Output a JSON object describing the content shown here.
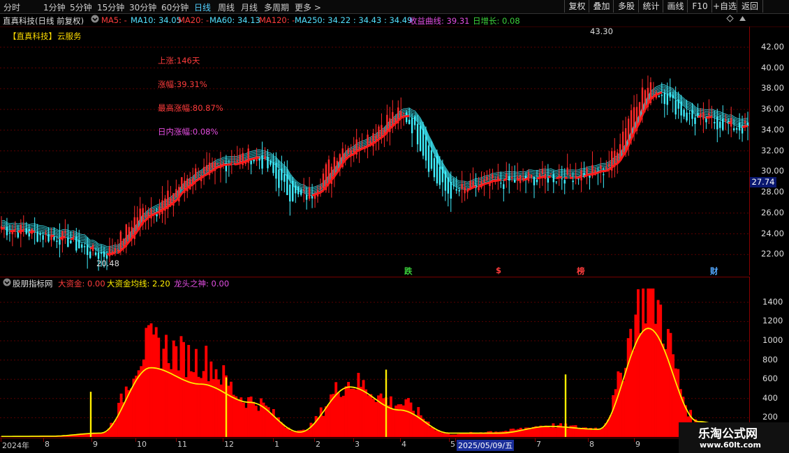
{
  "toolbar": {
    "periods": [
      "分时",
      "1分钟",
      "5分钟",
      "15分钟",
      "30分钟",
      "60分钟",
      "日线",
      "周线",
      "月线",
      "多周期",
      "更多 >"
    ],
    "active_period": "日线",
    "right_buttons": [
      "复权",
      "叠加",
      "多股",
      "统计",
      "画线",
      "F10",
      "+自选",
      "返回"
    ]
  },
  "info": {
    "title": "直真科技(日线 前复权)",
    "ma5": "MA5: -",
    "ma10": "MA10: 34.05",
    "ma20": "MA20: -",
    "ma60": "MA60: 34.13",
    "ma120": "MA120: -",
    "ma250": "MA250: 34.22 : 34.43 : 34.49",
    "profit": "收益曲线: 39.31",
    "daygrowth": "日增长: 0.08"
  },
  "cloud": {
    "stock": "【直真科技】",
    "service": "云服务"
  },
  "stats": {
    "rise_days": "上涨:146天",
    "change": "涨幅:39.31%",
    "max_change": "最高涨幅:80.87%",
    "intraday": "日内涨幅:0.08%"
  },
  "price": {
    "high_label": "43.30",
    "low_label": "20.48",
    "current_tag": "27.74",
    "yticks": [
      "42.00",
      "40.00",
      "38.00",
      "36.00",
      "34.00",
      "32.00",
      "30.00",
      "28.00",
      "26.00",
      "24.00",
      "22.00"
    ]
  },
  "markers": [
    "跌",
    "$",
    "榜",
    "财"
  ],
  "indicator": {
    "name": "股朋指标网",
    "big_fund": "大资金: 0.00",
    "big_fund_avg": "大资金均线: 2.20",
    "dragon": "龙头之神: 0.00",
    "yticks": [
      "1400",
      "1200",
      "1000",
      "800",
      "600",
      "400",
      "200"
    ]
  },
  "dates": [
    "2024年",
    "8",
    "9",
    "10",
    "11",
    "12",
    "1",
    "2",
    "3",
    "4",
    "5",
    "2025/05/09/五",
    "7",
    "8",
    "9"
  ],
  "watermark": {
    "name": "乐淘公式网",
    "url": "www.60lt.com"
  },
  "chart_data": {
    "type": "line",
    "price": {
      "ylim": [
        20,
        44
      ],
      "x": [
        "2024-07",
        "2024-08",
        "2024-09",
        "2024-10",
        "2024-11",
        "2024-12",
        "2025-01",
        "2025-02",
        "2025-03",
        "2025-04",
        "2025-05",
        "2025-06",
        "2025-07",
        "2025-08",
        "2025-09",
        "2025-10"
      ],
      "close": [
        24.5,
        23.8,
        22.0,
        26.5,
        30.0,
        31.5,
        27.5,
        32.5,
        35.5,
        28.0,
        29.0,
        29.5,
        30.0,
        38.0,
        35.0,
        34.2
      ],
      "high_point": {
        "value": 43.3
      },
      "low_point": {
        "value": 20.48
      }
    },
    "indicator": {
      "ylim": [
        0,
        1500
      ],
      "months": [
        "2024-07",
        "2024-08",
        "2024-09",
        "2024-10",
        "2024-11",
        "2024-12",
        "2025-01",
        "2025-02",
        "2025-03",
        "2025-04",
        "2025-05",
        "2025-06",
        "2025-07",
        "2025-08",
        "2025-09",
        "2025-10"
      ],
      "big_fund_peaks": [
        5,
        10,
        40,
        950,
        800,
        380,
        60,
        570,
        350,
        30,
        60,
        120,
        90,
        1470,
        150,
        30
      ],
      "big_fund_avg_peaks": [
        5,
        8,
        40,
        720,
        550,
        360,
        50,
        520,
        280,
        40,
        40,
        110,
        80,
        1130,
        160,
        30
      ]
    }
  }
}
